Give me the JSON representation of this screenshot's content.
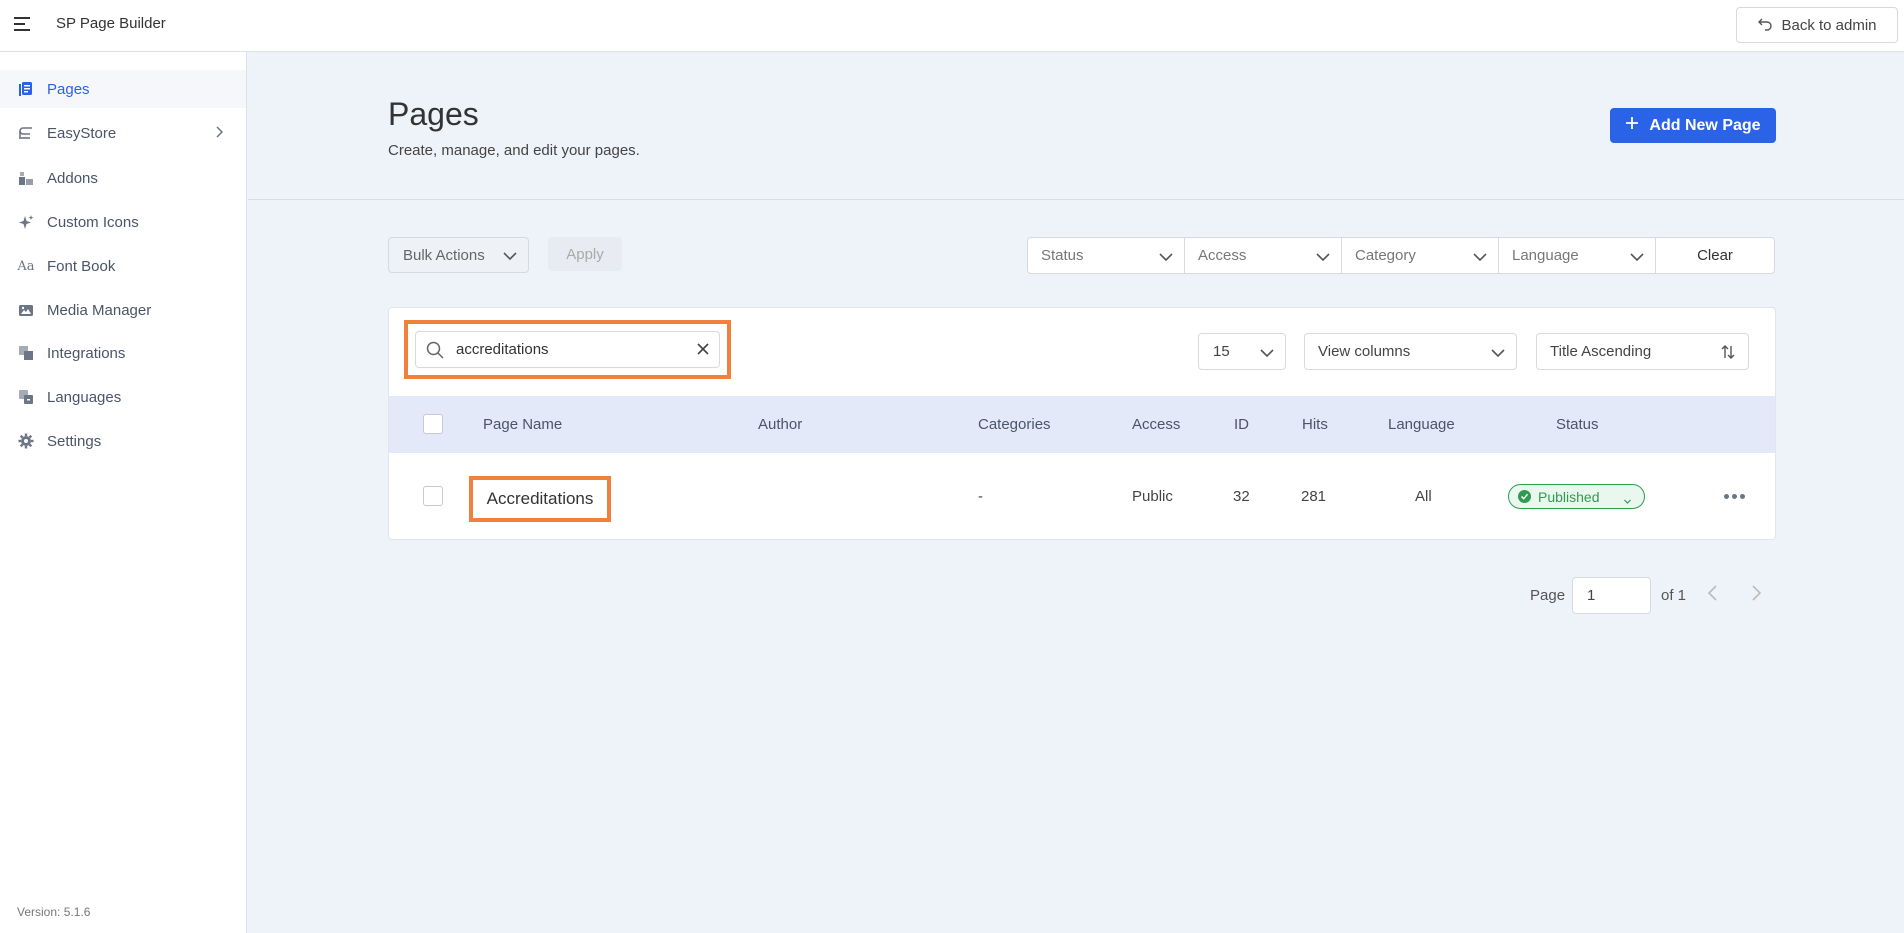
{
  "app": {
    "title": "SP Page Builder",
    "back_label": "Back to admin",
    "version": "Version: 5.1.6"
  },
  "sidebar": {
    "items": [
      {
        "label": "Pages",
        "icon": "pages-icon",
        "active": true
      },
      {
        "label": "EasyStore",
        "icon": "easystore-icon",
        "has_submenu": true
      },
      {
        "label": "Addons",
        "icon": "addons-icon"
      },
      {
        "label": "Custom Icons",
        "icon": "sparkle-icon"
      },
      {
        "label": "Font Book",
        "icon": "font-icon"
      },
      {
        "label": "Media Manager",
        "icon": "media-icon"
      },
      {
        "label": "Integrations",
        "icon": "integrations-icon"
      },
      {
        "label": "Languages",
        "icon": "languages-icon"
      },
      {
        "label": "Settings",
        "icon": "gear-icon"
      }
    ]
  },
  "header": {
    "title": "Pages",
    "subtitle": "Create, manage, and edit your pages.",
    "add_label": "Add New Page"
  },
  "toolbar": {
    "bulk_label": "Bulk Actions",
    "apply_label": "Apply",
    "filters": [
      "Status",
      "Access",
      "Category",
      "Language"
    ],
    "clear_label": "Clear"
  },
  "search": {
    "value": "accreditations"
  },
  "controls": {
    "per_page": "15",
    "view_columns": "View columns",
    "sort": "Title Ascending"
  },
  "table": {
    "columns": [
      "Page Name",
      "Author",
      "Categories",
      "Access",
      "ID",
      "Hits",
      "Language",
      "Status"
    ],
    "rows": [
      {
        "name": "Accreditations",
        "author": "",
        "categories": "-",
        "access": "Public",
        "id": "32",
        "hits": "281",
        "language": "All",
        "status": "Published"
      }
    ]
  },
  "pagination": {
    "page_label": "Page",
    "current": "1",
    "of_label": "of 1"
  },
  "colors": {
    "accent": "#2a62e8",
    "highlight": "#f0803c",
    "published": "#2e9c4e"
  }
}
